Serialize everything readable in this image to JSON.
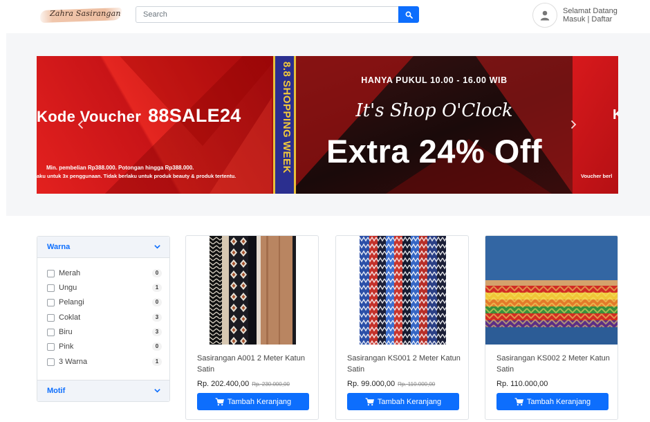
{
  "header": {
    "logo_text": "Zahra Sasirangan",
    "search_placeholder": "Search",
    "welcome": "Selamat Datang",
    "login": "Masuk",
    "separator": " | ",
    "register": "Daftar"
  },
  "banner": {
    "voucher_label": "Kode Voucher",
    "voucher_code": "88SALE24",
    "voucher_note_1": "Min. pembelian Rp388.000. Potongan hingga Rp388.000.",
    "voucher_note_2": "aku untuk 3x penggunaan. Tidak berlaku untuk produk beauty & produk tertentu.",
    "strip_text": "8.8 SHOPPING WEEK",
    "time_text": "HANYA PUKUL 10.00 - 16.00 WIB",
    "tagline": "It's Shop O'Clock",
    "headline": "Extra 24% Off",
    "right_letter": "K",
    "right_note": "Voucher berl"
  },
  "filters": {
    "warna_title": "Warna",
    "motif_title": "Motif",
    "options": [
      {
        "label": "Merah",
        "count": "0"
      },
      {
        "label": "Ungu",
        "count": "1"
      },
      {
        "label": "Pelangi",
        "count": "0"
      },
      {
        "label": "Coklat",
        "count": "3"
      },
      {
        "label": "Biru",
        "count": "3"
      },
      {
        "label": "Pink",
        "count": "0"
      },
      {
        "label": "3 Warna",
        "count": "1"
      }
    ]
  },
  "products": [
    {
      "name": "Sasirangan A001 2 Meter Katun Satin",
      "price": "Rp. 202.400,00",
      "old_price": "Rp. 230.000,00",
      "button": "Tambah Keranjang"
    },
    {
      "name": "Sasirangan KS001 2 Meter Katun Satin",
      "price": "Rp. 99.000,00",
      "old_price": "Rp. 110.000,00",
      "button": "Tambah Keranjang"
    },
    {
      "name": "Sasirangan KS002 2 Meter Katun Satin",
      "price": "Rp. 110.000,00",
      "old_price": "",
      "button": "Tambah Keranjang"
    }
  ],
  "colors": {
    "primary": "#0d6efd",
    "banner_red": "#d8191c",
    "banner_strip": "#2b2f8f",
    "strip_text": "#f2c93b"
  }
}
